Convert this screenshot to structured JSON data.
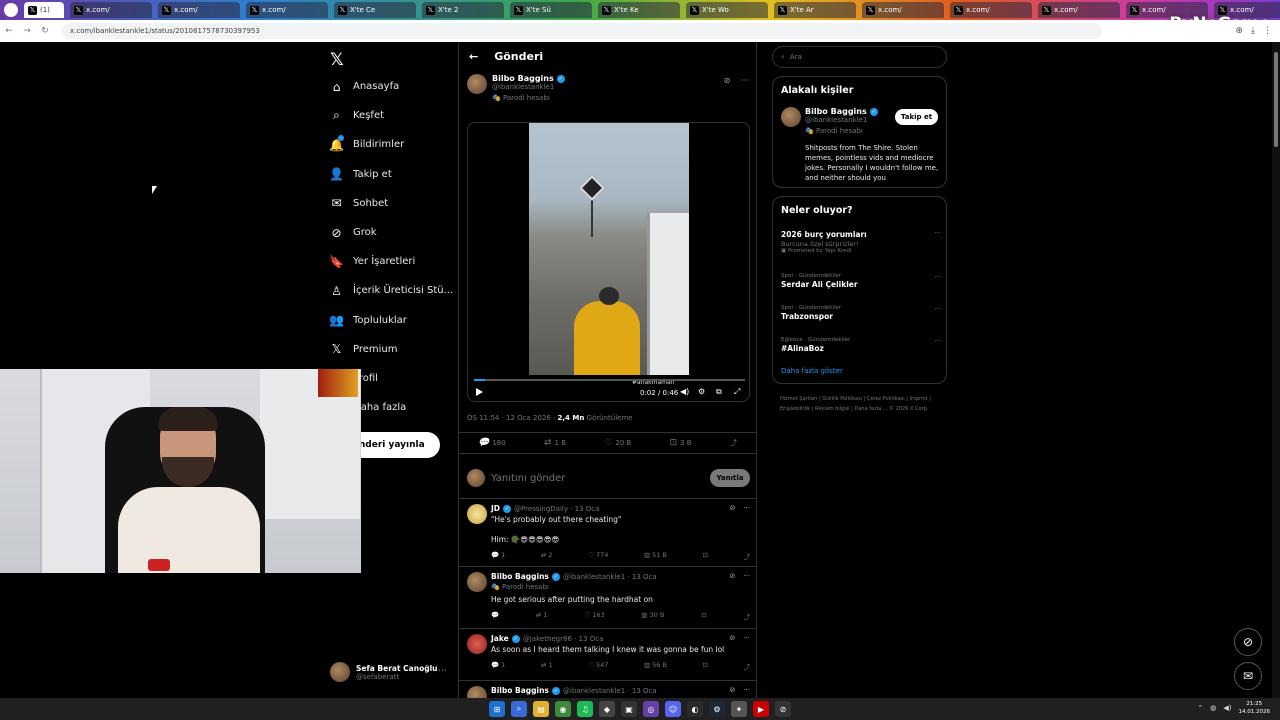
{
  "browser": {
    "tabs": [
      {
        "label": "(1)",
        "active": true
      },
      {
        "label": "x.com/"
      },
      {
        "label": "x.com/"
      },
      {
        "label": "x.com/"
      },
      {
        "label": "X'te Ce"
      },
      {
        "label": "X'te 2"
      },
      {
        "label": "X'te Sü"
      },
      {
        "label": "X'te Ke"
      },
      {
        "label": "X'te Wo"
      },
      {
        "label": "X'te Ar"
      },
      {
        "label": "x.com/"
      },
      {
        "label": "x.com/"
      },
      {
        "label": "x.com/"
      },
      {
        "label": "x.com/"
      },
      {
        "label": "x.com/"
      },
      {
        "label": "x.com/"
      },
      {
        "label": "x.com/"
      },
      {
        "label": "x.com/"
      },
      {
        "label": "x.com/"
      },
      {
        "label": "x.com/"
      },
      {
        "label": "x.com/"
      },
      {
        "label": "x.com/"
      },
      {
        "label": "x.com/"
      },
      {
        "label": "x.com/"
      },
      {
        "label": "X'te Ju"
      }
    ],
    "new_tab": "+",
    "url": "x.com/ibanklestankle1/status/2010817578730397953",
    "watermark": "ByNoGame"
  },
  "sidenav": {
    "logo": "𝕏",
    "items": [
      {
        "label": "Anasayfa",
        "icon": "home-icon"
      },
      {
        "label": "Keşfet",
        "icon": "search-icon"
      },
      {
        "label": "Bildirimler",
        "icon": "bell-icon"
      },
      {
        "label": "Takip et",
        "icon": "add-person-icon"
      },
      {
        "label": "Sohbet",
        "icon": "mail-icon"
      },
      {
        "label": "Grok",
        "icon": "grok-icon"
      },
      {
        "label": "Yer İşaretleri",
        "icon": "bookmark-icon"
      },
      {
        "label": "İçerik Üreticisi Stü...",
        "icon": "creator-icon"
      },
      {
        "label": "Topluluklar",
        "icon": "communities-icon"
      },
      {
        "label": "Premium",
        "icon": "x-icon"
      },
      {
        "label": "Profil",
        "icon": "profile-icon"
      },
      {
        "label": "Daha fazla",
        "icon": "more-icon"
      }
    ],
    "post_button": "Gönderi yayınla",
    "user": {
      "name": "Sefa Berat Canoğlu",
      "handle": "@sefaberatt"
    }
  },
  "post": {
    "header": "Gönderi",
    "author": {
      "name": "Bilbo Baggins",
      "handle": "@ibanklestankle1",
      "parody": "Parodi hesabı"
    },
    "video": {
      "time": "0:02 / 0:46",
      "hashtag": "#anakmamah",
      "progress": 0.04
    },
    "meta": {
      "time": "ÖS 11:54 · 12 Oca 2026 · ",
      "views": "2,4 Mn",
      "views_label": " Görüntüleme"
    },
    "stats": {
      "replies": "180",
      "reposts": "1 B",
      "likes": "20 B",
      "bookmarks": "3 B"
    },
    "reply_placeholder": "Yanıtını gönder",
    "reply_button": "Yanıtla"
  },
  "replies": [
    {
      "name": "JD",
      "handle": "@PressingDaily · 13 Oca",
      "lines": [
        "\"He's probably out there cheating\"",
        "",
        "Him: 🪖😎😎😎😎😎"
      ],
      "stats": [
        "1",
        "2",
        "774",
        "51 B"
      ]
    },
    {
      "name": "Bilbo Baggins",
      "handle": "@ibanklestankle1 · 13 Oca",
      "parody": "Parodi hesabı",
      "lines": [
        "He got serious after putting the hardhat on"
      ],
      "stats": [
        "",
        "1",
        "163",
        "30 B"
      ]
    },
    {
      "name": "Jake",
      "handle": "@Jakethegr86 · 13 Oca",
      "lines": [
        "As soon as I heard them talking I knew it was gonna be fun lol"
      ],
      "stats": [
        "1",
        "1",
        "547",
        "56 B"
      ]
    },
    {
      "name": "Bilbo Baggins",
      "handle": "@ibanklestankle1 · 13 Oca",
      "lines": [],
      "stats": []
    }
  ],
  "right": {
    "search_placeholder": "Ara",
    "relevant": {
      "title": "Alakalı kişiler",
      "name": "Bilbo Baggins",
      "handle": "@ibanklestankle1",
      "parody": "Parodi hesabı",
      "follow": "Takip et",
      "bio": "Shitposts from The Shire. Stolen memes, pointless vids and mediocre jokes. Personally I wouldn't follow me, and neither should you"
    },
    "trends": {
      "title": "Neler oluyor?",
      "items": [
        {
          "meta": "",
          "name": "2026 burç yorumları",
          "sub": "Burcuna özel sürprizler!",
          "promo": "Promoted by Yapı Kredi"
        },
        {
          "meta": "Spor · Gündemdekiler",
          "name": "Serdar Ali Çelikler"
        },
        {
          "meta": "Spor · Gündemdekiler",
          "name": "Trabzonspor"
        },
        {
          "meta": "Eğlence · Gündemdekiler",
          "name": "#AlinaBoz"
        }
      ],
      "show_more": "Daha fazla göster"
    },
    "footer": "Hizmet Şartları | Gizlilik Politikası | Çerez Politikası | İmprint | Erişilebilirlik | Reklam bilgisi | Daha fazla ... © 2026 X Corp."
  },
  "taskbar": {
    "time": "21:25",
    "date": "14.01.2026"
  }
}
